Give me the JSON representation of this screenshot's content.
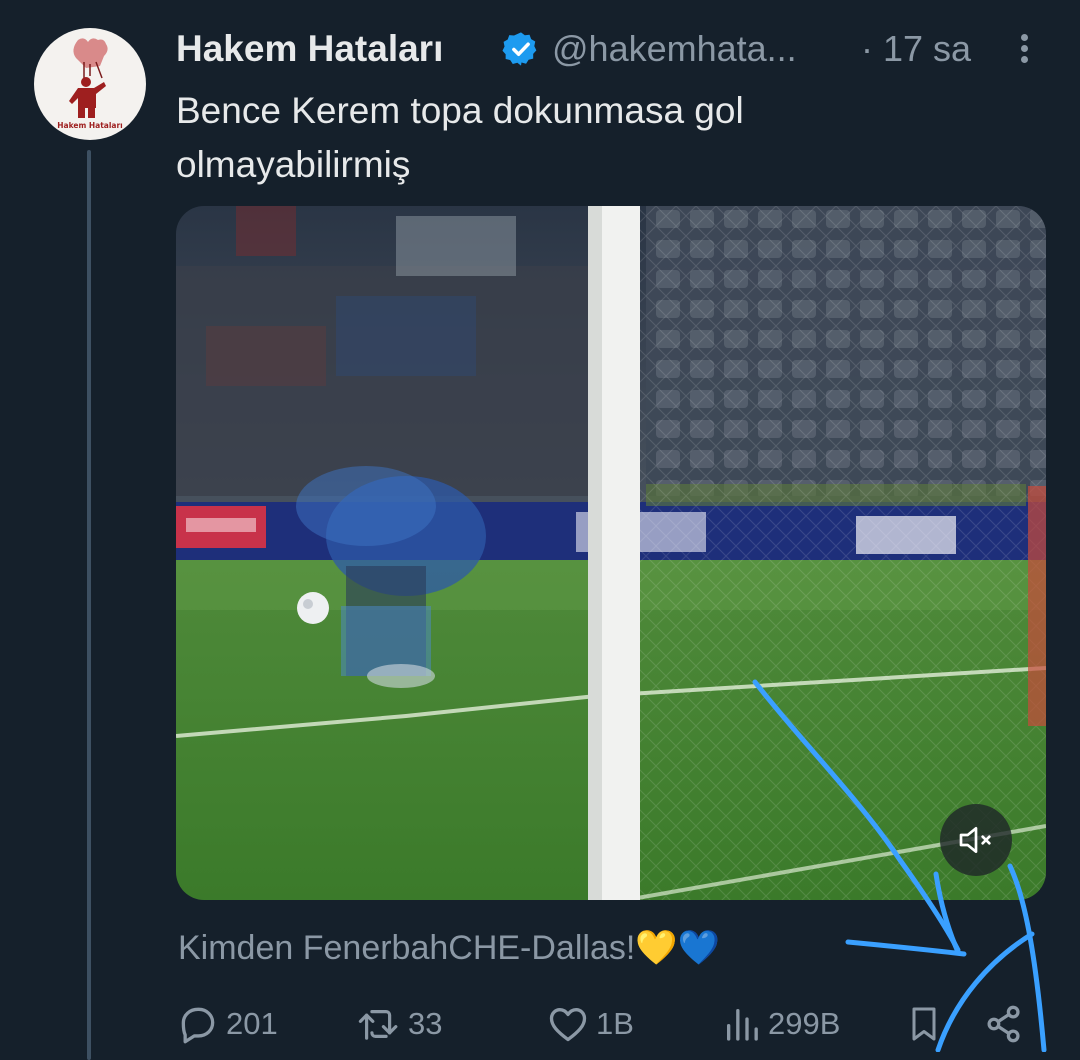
{
  "author": {
    "name": "Hakem Hataları",
    "handle": "@hakemhata...",
    "time": "· 17 sa",
    "avatar_text": "Hakem Hataları",
    "verified": true
  },
  "tweet": {
    "text_line1": "Bence Kerem topa dokunmasa gol",
    "text_line2": "olmayabilirmiş",
    "source": "Kimden FenerbahCHE-Dallas!💛💙"
  },
  "media": {
    "type": "video",
    "muted": true
  },
  "actions": {
    "replies": "201",
    "retweets": "33",
    "likes": "1B",
    "views": "299B"
  },
  "colors": {
    "background": "#15202b",
    "text": "#e7e9ea",
    "muted": "#8b98a5",
    "verified": "#1d9bf0",
    "annotation": "#3aa0ff"
  },
  "icons": [
    "verified-badge-icon",
    "more-icon",
    "mute-icon",
    "reply-icon",
    "retweet-icon",
    "like-icon",
    "views-icon",
    "bookmark-icon",
    "share-icon"
  ]
}
